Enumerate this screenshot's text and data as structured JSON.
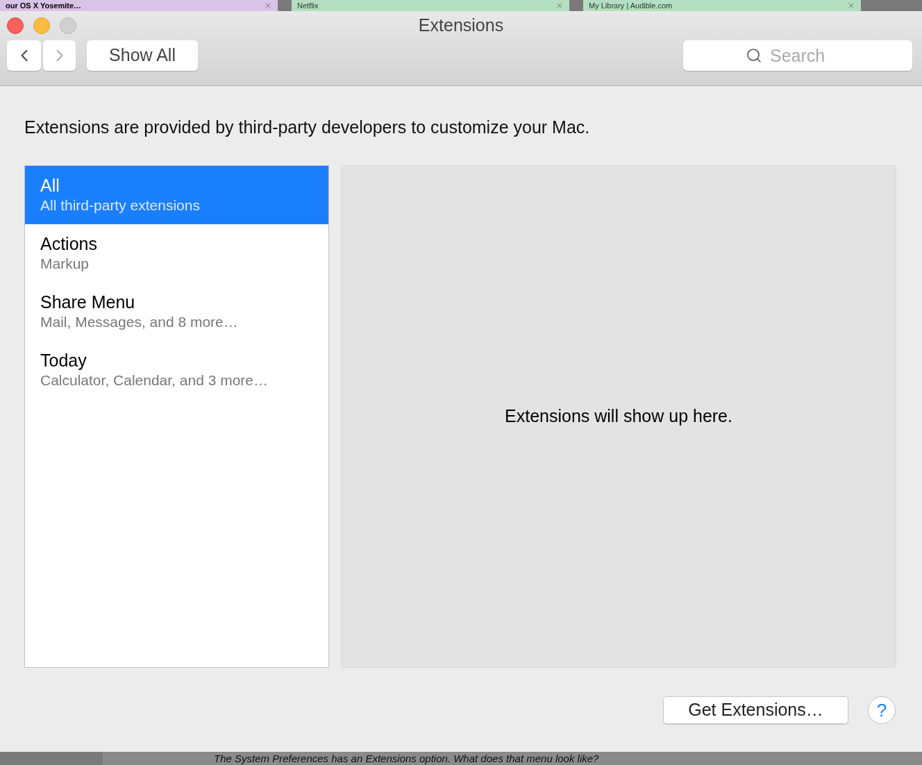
{
  "browser_tabs": [
    {
      "label": "our OS X Yosemite…",
      "selected": true,
      "color": "#d9c3e6"
    },
    {
      "label": "Netflix",
      "selected": false,
      "color": "#b3dfc0"
    },
    {
      "label": "My Library | Audible.com",
      "selected": false,
      "color": "#b3dfc0"
    }
  ],
  "window": {
    "title": "Extensions"
  },
  "toolbar": {
    "show_all": "Show All",
    "search": {
      "placeholder": "Search"
    }
  },
  "description": "Extensions are provided by third-party developers to customize your Mac.",
  "categories": [
    {
      "name": "All",
      "detail": "All third-party extensions",
      "selected": true
    },
    {
      "name": "Actions",
      "detail": "Markup",
      "selected": false
    },
    {
      "name": "Share Menu",
      "detail": "Mail, Messages, and 8 more…",
      "selected": false
    },
    {
      "name": "Today",
      "detail": "Calculator, Calendar, and 3 more…",
      "selected": false
    }
  ],
  "detail_panel": {
    "message": "Extensions will show up here."
  },
  "get_extensions_button": "Get Extensions…",
  "help_button": "?",
  "background_text": "The System Preferences has an Extensions option. What does that menu look like?"
}
